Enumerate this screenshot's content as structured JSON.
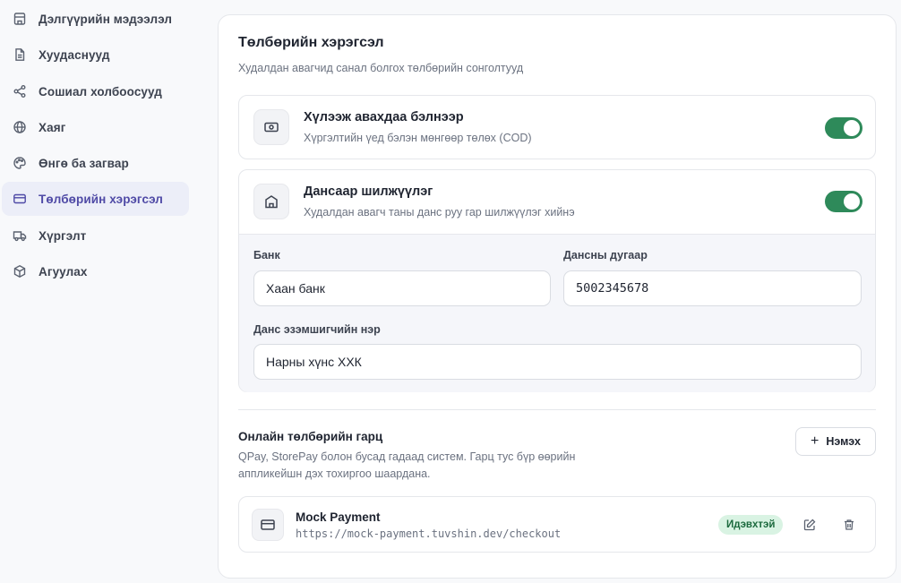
{
  "sidebar": {
    "items": [
      {
        "label": "Дэлгүүрийн мэдээлэл",
        "icon": "store-icon"
      },
      {
        "label": "Хуудаснууд",
        "icon": "file-text-icon"
      },
      {
        "label": "Сошиал холбоосууд",
        "icon": "share-icon"
      },
      {
        "label": "Хаяг",
        "icon": "globe-icon"
      },
      {
        "label": "Өнгө ба загвар",
        "icon": "palette-icon"
      },
      {
        "label": "Төлбөрийн хэрэгсэл",
        "icon": "credit-card-icon",
        "active": true
      },
      {
        "label": "Хүргэлт",
        "icon": "truck-icon"
      },
      {
        "label": "Агуулах",
        "icon": "box-icon"
      }
    ]
  },
  "payment": {
    "title": "Төлбөрийн хэрэгсэл",
    "subtitle": "Худалдан авагчид санал болгох төлбөрийн сонголтууд",
    "cod": {
      "title": "Хүлээж авахдаа бэлнээр",
      "subtitle": "Хүргэлтийн үед бэлэн мөнгөөр төлөх (COD)",
      "enabled": true,
      "icon": "banknote-icon"
    },
    "bank_transfer": {
      "title": "Дансаар шилжүүлэг",
      "subtitle": "Худалдан авагч таны данс руу гар шилжүүлэг хийнэ",
      "enabled": true,
      "icon": "bank-icon",
      "bank_label": "Банк",
      "bank_value": "Хаан банк",
      "account_label": "Дансны дугаар",
      "account_value": "5002345678",
      "holder_label": "Данс эзэмшигчийн нэр",
      "holder_value": "Нарны хүнс ХХК"
    },
    "gateways": {
      "title": "Онлайн төлбөрийн гарц",
      "description": "QPay, StorePay болон бусад гадаад систем. Гарц тус бүр өөрийн аппликейшн дэх тохиргоо шаардана.",
      "add_label": "Нэмэх",
      "items": [
        {
          "name": "Mock Payment",
          "url": "https://mock-payment.tuvshin.dev/checkout",
          "status": "Идэвхтэй",
          "icon": "credit-card-icon"
        }
      ]
    }
  },
  "colors": {
    "accent": "#4f4aa6",
    "toggle_on": "#2e8a5a",
    "badge_bg": "#d9f3e3",
    "badge_text": "#1c6a3e"
  }
}
